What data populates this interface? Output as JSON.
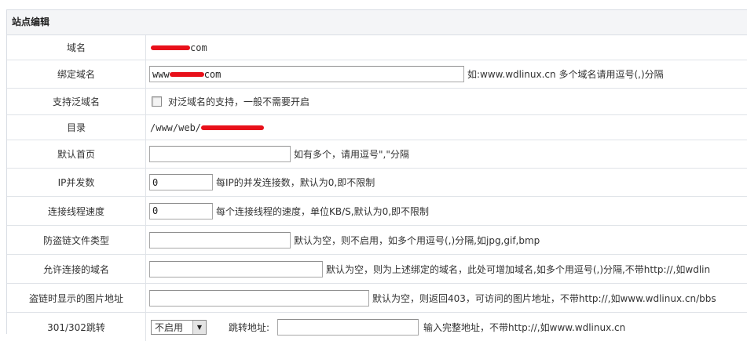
{
  "panel": {
    "title": "站点编辑"
  },
  "rows": {
    "domain": {
      "label": "域名",
      "value_prefix": "",
      "value_suffix": "com"
    },
    "bind_domain": {
      "label": "绑定域名",
      "value_prefix": "www",
      "value_suffix": "com",
      "hint": "如:www.wdlinux.cn 多个域名请用逗号(,)分隔"
    },
    "wildcard": {
      "label": "支持泛域名",
      "checkbox_label": "对泛域名的支持，一般不需要开启"
    },
    "directory": {
      "label": "目录",
      "value_prefix": "/www/web/"
    },
    "default_index": {
      "label": "默认首页",
      "value": "",
      "hint": "如有多个，请用逗号\",\"分隔"
    },
    "ip_conn": {
      "label": "IP并发数",
      "value": "0",
      "hint": "每IP的并发连接数，默认为0,即不限制"
    },
    "thread_speed": {
      "label": "连接线程速度",
      "value": "0",
      "hint": "每个连接线程的速度，单位KB/S,默认为0,即不限制"
    },
    "hotlink_types": {
      "label": "防盗链文件类型",
      "value": "",
      "hint": "默认为空，则不启用，如多个用逗号(,)分隔,如jpg,gif,bmp"
    },
    "allowed_domains": {
      "label": "允许连接的域名",
      "value": "",
      "hint": "默认为空，则为上述绑定的域名，此处可增加域名,如多个用逗号(,)分隔,不带http://,如wdlin"
    },
    "hotlink_image": {
      "label": "盗链时显示的图片地址",
      "value": "",
      "hint": "默认为空，则返回403，可访问的图片地址，不带http://,如www.wdlinux.cn/bbs"
    },
    "redirect": {
      "label": "301/302跳转",
      "select_value": "不启用",
      "redirect_label": "跳转地址:",
      "value": "",
      "hint": "输入完整地址，不带http://,如www.wdlinux.cn"
    }
  }
}
